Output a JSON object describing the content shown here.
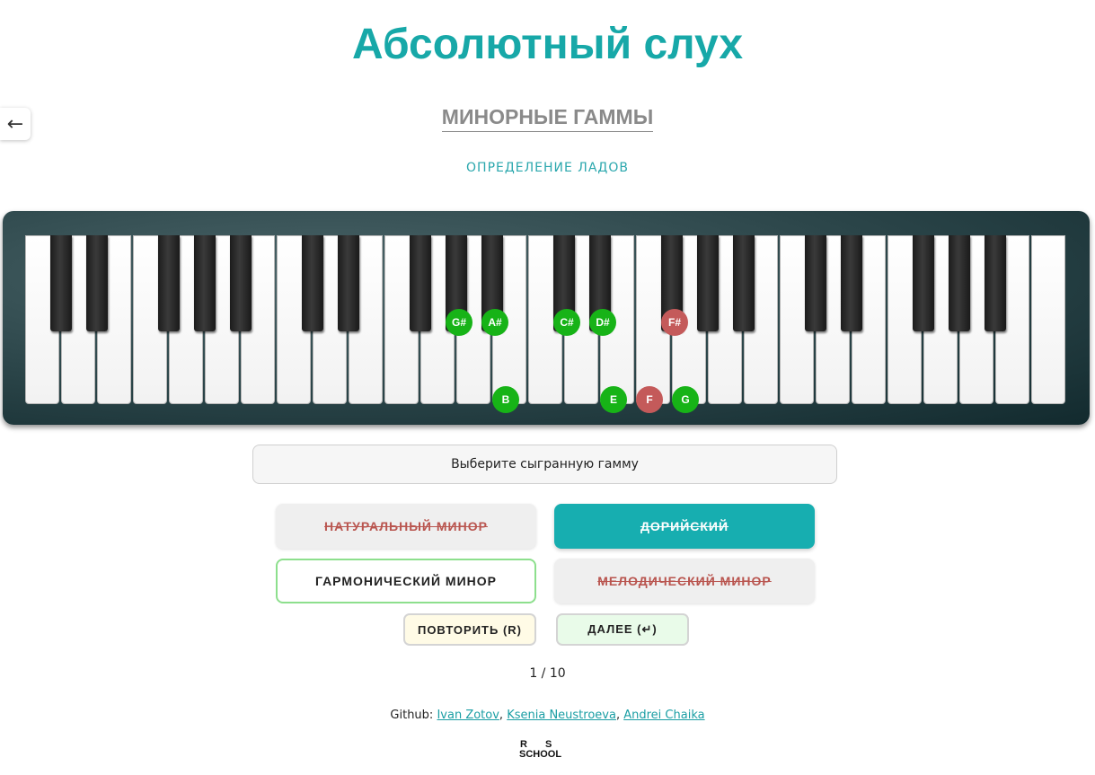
{
  "header": {
    "title": "Абсолютный слух",
    "back_icon": "←"
  },
  "section": {
    "title": "МИНОРНЫЕ ГАММЫ",
    "mode_link": "ОПРЕДЕЛЕНИЕ ЛАДОВ"
  },
  "piano": {
    "white_key_count": 29,
    "black_key_count": 20,
    "markers_black": [
      {
        "label": "G#",
        "state": "correct"
      },
      {
        "label": "A#",
        "state": "correct"
      },
      {
        "label": "C#",
        "state": "correct"
      },
      {
        "label": "D#",
        "state": "correct"
      },
      {
        "label": "F#",
        "state": "wrong"
      }
    ],
    "markers_white": [
      {
        "label": "B",
        "state": "correct"
      },
      {
        "label": "E",
        "state": "correct"
      },
      {
        "label": "F",
        "state": "wrong"
      },
      {
        "label": "G",
        "state": "correct"
      }
    ]
  },
  "prompt": "Выберите сыгранную гамму",
  "answers": [
    {
      "label": "НАТУРАЛЬНЫЙ МИНОР",
      "state": "wrong"
    },
    {
      "label": "ДОРИЙСКИЙ",
      "state": "selected-wrong"
    },
    {
      "label": "ГАРМОНИЧЕСКИЙ МИНОР",
      "state": "correct"
    },
    {
      "label": "МЕЛОДИЧЕСКИЙ МИНОР",
      "state": "wrong"
    }
  ],
  "controls": {
    "repeat": "ПОВТОРИТЬ (R)",
    "next": "ДАЛЕЕ (↵)"
  },
  "counter": "1 / 10",
  "footer": {
    "prefix": "Github:",
    "authors": [
      "Ivan Zotov",
      "Ksenia Neustroeva",
      "Andrei Chaika"
    ],
    "sep": ","
  },
  "logo": {
    "line1_a": "R",
    "line1_b": "S",
    "line2": "SCHOOL"
  },
  "colors": {
    "accent": "#17aeb0",
    "correct": "#17b317",
    "wrong": "#c45a5a",
    "title": "#17a8a8"
  }
}
